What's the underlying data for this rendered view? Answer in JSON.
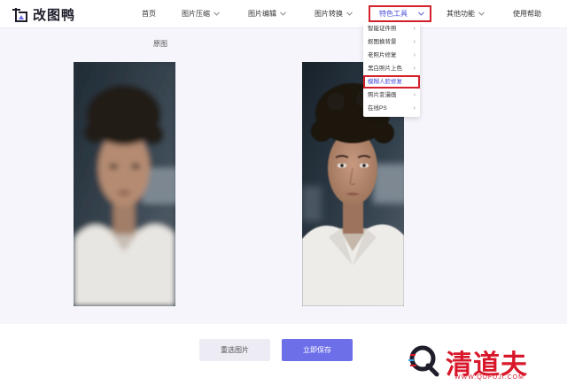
{
  "brand": {
    "name": "改图鸭"
  },
  "nav": {
    "items": [
      {
        "label": "首页"
      },
      {
        "label": "图片压缩"
      },
      {
        "label": "图片编辑"
      },
      {
        "label": "图片转换"
      },
      {
        "label": "特色工具"
      },
      {
        "label": "其他功能"
      },
      {
        "label": "使用帮助"
      }
    ],
    "active": "特色工具"
  },
  "dropdown": {
    "items": [
      {
        "label": "智能证件照"
      },
      {
        "label": "抠图换背景"
      },
      {
        "label": "老照片修复"
      },
      {
        "label": "黑白照片上色"
      },
      {
        "label": "模糊人脸修复"
      },
      {
        "label": "照片变漫画"
      },
      {
        "label": "在线PS"
      }
    ],
    "highlighted": "模糊人脸修复"
  },
  "main": {
    "original_label": "原图"
  },
  "actions": {
    "reselect_label": "重选图片",
    "save_label": "立即保存"
  },
  "watermark": {
    "name": "清道夫",
    "url": "WWW.QDFUJI.COM"
  },
  "colors": {
    "accent": "#6c6fe8",
    "highlight_border": "#d6202a",
    "active_text": "#4a4dd8",
    "watermark": "#d8182a"
  }
}
